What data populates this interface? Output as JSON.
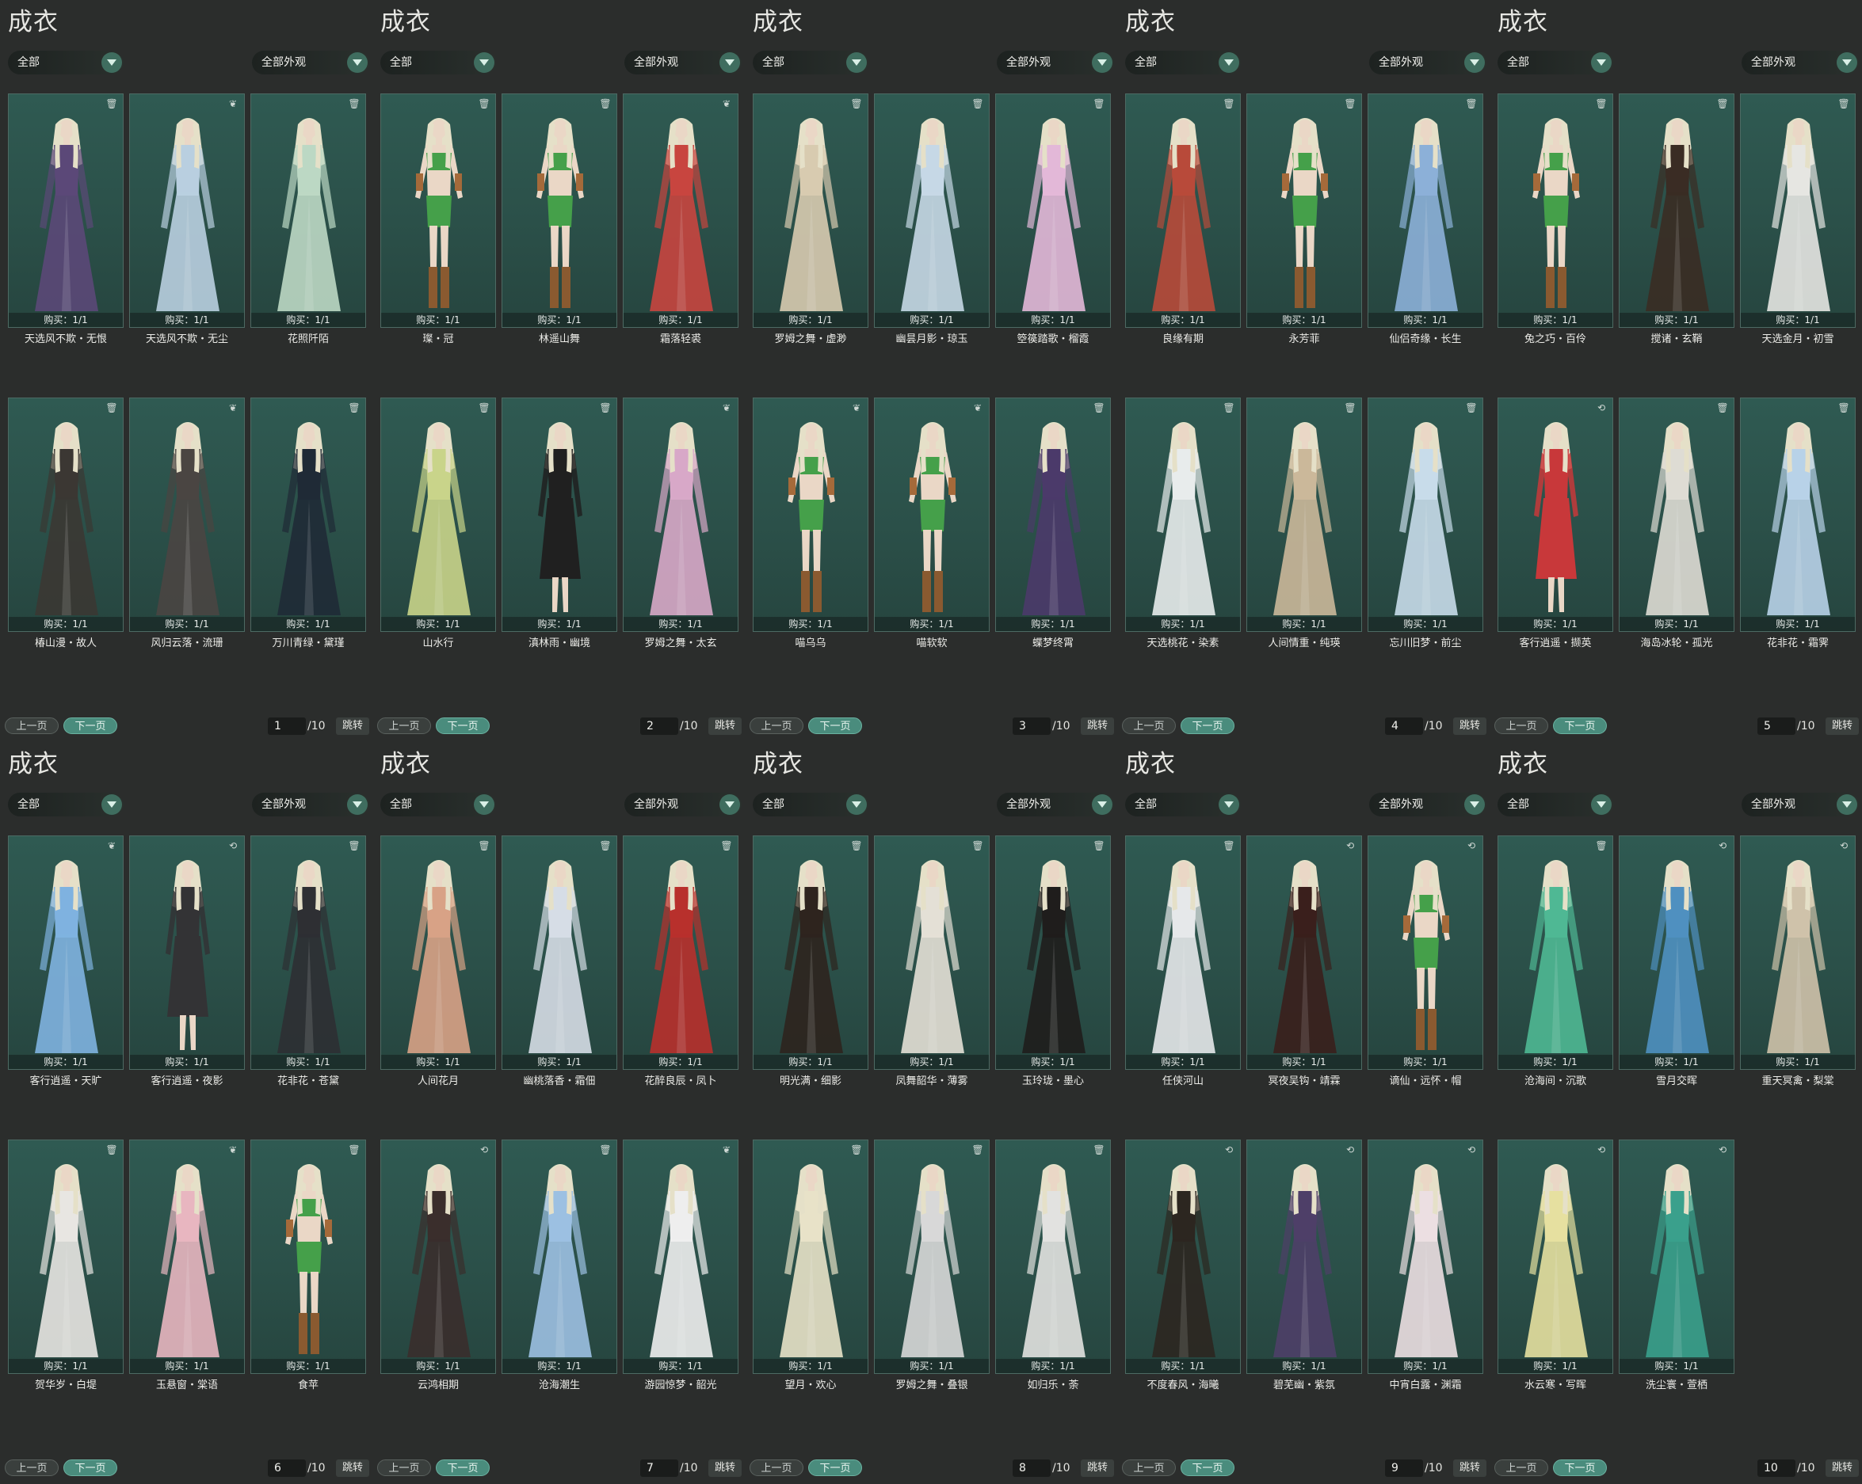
{
  "colors": {
    "background": "#2b2d2c",
    "card_bg": "#2b5049",
    "accent": "#4a8c7d",
    "hair": "#e5e0c8",
    "skin": "#ead7c6"
  },
  "common": {
    "title": "成衣",
    "category_filter": "全部",
    "look_filter": "全部外观",
    "prev_label": "上一页",
    "next_label": "下一页",
    "jump_label": "跳转",
    "buy_label": "购买：1/1",
    "page_total": "/10"
  },
  "panels": [
    {
      "page": "1",
      "items": [
        {
          "name": "天选风不欺・无恨",
          "icon": "trash",
          "outfit": "gown",
          "color": "#5b4878"
        },
        {
          "name": "天选风不欺・无尘",
          "icon": "butterfly",
          "outfit": "gown",
          "color": "#b9cfe0"
        },
        {
          "name": "花照阡陌",
          "icon": "trash",
          "outfit": "gown",
          "color": "#bcd8c4"
        },
        {
          "name": "椿山漫・故人",
          "icon": "trash",
          "outfit": "gown",
          "color": "#3b3733"
        },
        {
          "name": "风归云落・流珊",
          "icon": "butterfly",
          "outfit": "gown",
          "color": "#4a4542"
        },
        {
          "name": "万川青绿・黛瑾",
          "icon": "trash",
          "outfit": "gown",
          "color": "#1f2a36"
        }
      ]
    },
    {
      "page": "2",
      "items": [
        {
          "name": "璨・冠",
          "icon": "trash",
          "outfit": "bikini",
          "color": "#45a04a"
        },
        {
          "name": "林遥山舞",
          "icon": "trash",
          "outfit": "bikini",
          "color": "#45a04a"
        },
        {
          "name": "霜落轻裘",
          "icon": "butterfly",
          "outfit": "gown",
          "color": "#c8453f"
        },
        {
          "name": "山水行",
          "icon": "trash",
          "outfit": "gown",
          "color": "#c9d48a"
        },
        {
          "name": "滇林雨・幽境",
          "icon": "trash",
          "outfit": "skirt",
          "color": "#202020"
        },
        {
          "name": "罗姆之舞・太玄",
          "icon": "butterfly",
          "outfit": "gown",
          "color": "#d8a8c8"
        }
      ]
    },
    {
      "page": "3",
      "items": [
        {
          "name": "罗姆之舞・虚渺",
          "icon": "trash",
          "outfit": "gown",
          "color": "#d8cbb0"
        },
        {
          "name": "幽昙月影・琼玉",
          "icon": "trash",
          "outfit": "gown",
          "color": "#c6d8e6"
        },
        {
          "name": "箜篌踏歌・榴霞",
          "icon": "trash",
          "outfit": "gown",
          "color": "#e3b8d8"
        },
        {
          "name": "喵乌乌",
          "icon": "butterfly",
          "outfit": "bikini",
          "color": "#45a04a"
        },
        {
          "name": "喵软软",
          "icon": "butterfly",
          "outfit": "bikini",
          "color": "#45a04a"
        },
        {
          "name": "蝶梦终霄",
          "icon": "trash",
          "outfit": "gown",
          "color": "#4b3a6a"
        }
      ]
    },
    {
      "page": "4",
      "items": [
        {
          "name": "良缘有期",
          "icon": "trash",
          "outfit": "gown",
          "color": "#b84a3a"
        },
        {
          "name": "永芳菲",
          "icon": "trash",
          "outfit": "bikini",
          "color": "#45a04a"
        },
        {
          "name": "仙侣奇缘・长生",
          "icon": "trash",
          "outfit": "gown",
          "color": "#8cb0d8"
        },
        {
          "name": "天选桃花・染素",
          "icon": "trash",
          "outfit": "gown",
          "color": "#e8ecec"
        },
        {
          "name": "人间情重・纯瑛",
          "icon": "trash",
          "outfit": "gown",
          "color": "#cbb89a"
        },
        {
          "name": "忘川旧梦・前尘",
          "icon": "trash",
          "outfit": "gown",
          "color": "#c8dcea"
        }
      ]
    },
    {
      "page": "5",
      "items": [
        {
          "name": "兔之巧・百伶",
          "icon": "trash",
          "outfit": "bikini",
          "color": "#45a04a"
        },
        {
          "name": "搅诸・玄鞘",
          "icon": "trash",
          "outfit": "gown",
          "color": "#3a2c24"
        },
        {
          "name": "天选金月・初雪",
          "icon": "trash",
          "outfit": "gown",
          "color": "#e6e6e2"
        },
        {
          "name": "客行逍遥・撷英",
          "icon": "swap",
          "outfit": "skirt",
          "color": "#c8383a"
        },
        {
          "name": "海岛冰轮・孤光",
          "icon": "trash",
          "outfit": "gown",
          "color": "#dedcd4"
        },
        {
          "name": "花非花・霜霁",
          "icon": "trash",
          "outfit": "gown",
          "color": "#b8d2e8"
        }
      ]
    },
    {
      "page": "6",
      "items": [
        {
          "name": "客行逍遥・天旷",
          "icon": "butterfly",
          "outfit": "gown",
          "color": "#7fb2e0"
        },
        {
          "name": "客行逍遥・夜影",
          "icon": "swap",
          "outfit": "skirt",
          "color": "#333335"
        },
        {
          "name": "花非花・苍黛",
          "icon": "trash",
          "outfit": "gown",
          "color": "#2e2f33"
        },
        {
          "name": "贺华岁・白堤",
          "icon": "trash",
          "outfit": "gown",
          "color": "#e8e6e2"
        },
        {
          "name": "玉悬窗・棠语",
          "icon": "butterfly",
          "outfit": "gown",
          "color": "#e8b6c0"
        },
        {
          "name": "食苹",
          "icon": "trash",
          "outfit": "bikini",
          "color": "#45a04a"
        }
      ]
    },
    {
      "page": "7",
      "items": [
        {
          "name": "人间花月",
          "icon": "trash",
          "outfit": "gown",
          "color": "#d8a286"
        },
        {
          "name": "幽桃落香・霜佃",
          "icon": "trash",
          "outfit": "gown",
          "color": "#d6dde6"
        },
        {
          "name": "花醉良辰・凤卜",
          "icon": "trash",
          "outfit": "gown",
          "color": "#b8302c"
        },
        {
          "name": "云鸿相期",
          "icon": "swap",
          "outfit": "gown",
          "color": "#3a2e2c"
        },
        {
          "name": "沧海潮生",
          "icon": "trash",
          "outfit": "gown",
          "color": "#9cc0e2"
        },
        {
          "name": "游园惊梦・韶光",
          "icon": "butterfly",
          "outfit": "gown",
          "color": "#eeeeee"
        }
      ]
    },
    {
      "page": "8",
      "items": [
        {
          "name": "明光满・细影",
          "icon": "trash",
          "outfit": "gown",
          "color": "#2e241e"
        },
        {
          "name": "凤舞韶华・薄雾",
          "icon": "trash",
          "outfit": "gown",
          "color": "#e4e0d6"
        },
        {
          "name": "玉玲珑・墨心",
          "icon": "trash",
          "outfit": "gown",
          "color": "#1f1d1c"
        },
        {
          "name": "望月・欢心",
          "icon": "trash",
          "outfit": "gown",
          "color": "#e8e2c8"
        },
        {
          "name": "罗姆之舞・叠银",
          "icon": "trash",
          "outfit": "gown",
          "color": "#d8d8d8"
        },
        {
          "name": "如归乐・荼",
          "icon": "trash",
          "outfit": "gown",
          "color": "#e2e2e0"
        }
      ]
    },
    {
      "page": "9",
      "items": [
        {
          "name": "任侠河山",
          "icon": "trash",
          "outfit": "gown",
          "color": "#e6e8ea"
        },
        {
          "name": "冥夜吴钩・靖霖",
          "icon": "swap",
          "outfit": "gown",
          "color": "#3a1f1c"
        },
        {
          "name": "谪仙・远怀・帽",
          "icon": "swap",
          "outfit": "bikini",
          "color": "#45a04a"
        },
        {
          "name": "不度春风・海曦",
          "icon": "swap",
          "outfit": "gown",
          "color": "#2c2620"
        },
        {
          "name": "碧芜幽・紫氛",
          "icon": "swap",
          "outfit": "gown",
          "color": "#4e3f68"
        },
        {
          "name": "中宵白露・渊霜",
          "icon": "swap",
          "outfit": "gown",
          "color": "#ecdfe2"
        }
      ]
    },
    {
      "page": "10",
      "items": [
        {
          "name": "沧海间・沉歌",
          "icon": "trash",
          "outfit": "gown",
          "color": "#4fb894"
        },
        {
          "name": "雪月交晖",
          "icon": "swap",
          "outfit": "gown",
          "color": "#4f90c0"
        },
        {
          "name": "重天冥禽・梨棠",
          "icon": "swap",
          "outfit": "gown",
          "color": "#cfc2aa"
        },
        {
          "name": "水云寒・写晖",
          "icon": "swap",
          "outfit": "gown",
          "color": "#e6e0a0"
        },
        {
          "name": "洗尘寰・萱栖",
          "icon": "swap",
          "outfit": "gown",
          "color": "#3aa08c"
        }
      ]
    }
  ]
}
